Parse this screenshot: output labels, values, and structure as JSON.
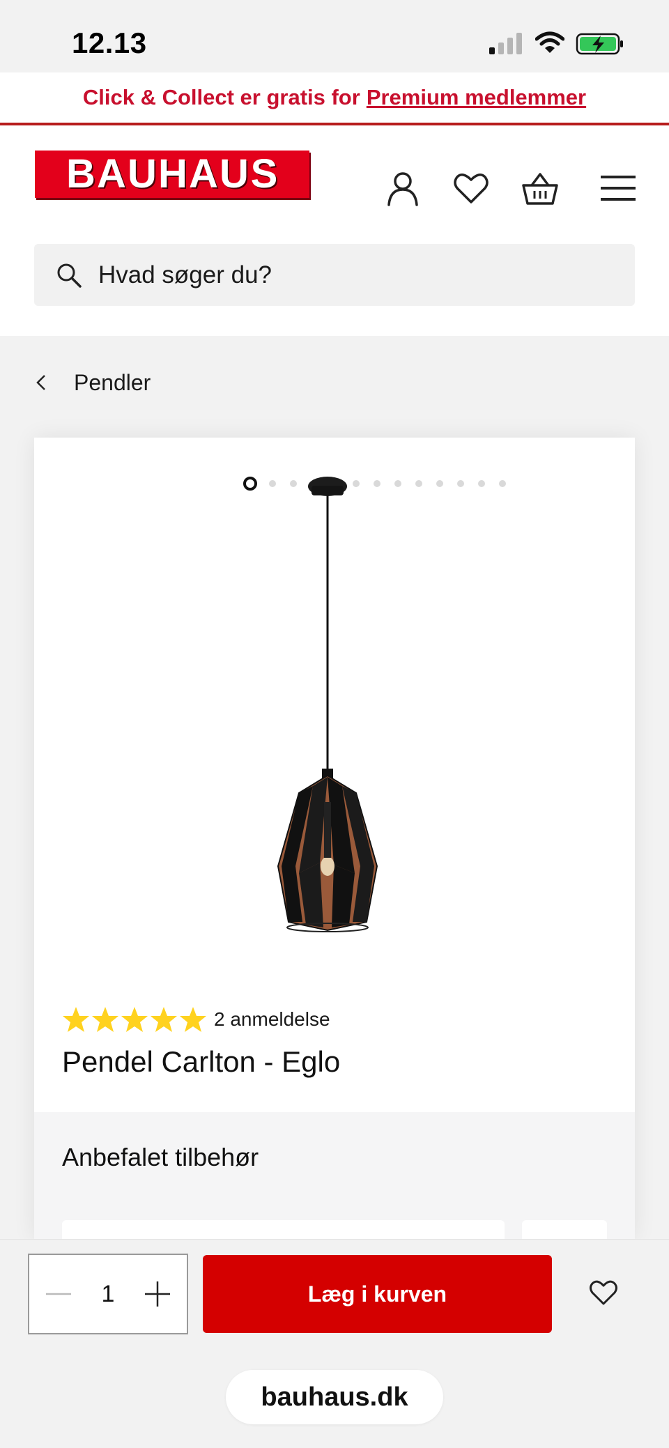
{
  "status_bar": {
    "time": "12.13"
  },
  "promo": {
    "text": "Click & Collect er gratis for",
    "link": "Premium medlemmer"
  },
  "header": {
    "logo_text": "BAUHAUS",
    "icons": [
      "user-icon",
      "heart-icon",
      "basket-icon",
      "menu-icon"
    ]
  },
  "search": {
    "placeholder": "Hvad søger du?"
  },
  "breadcrumb": {
    "label": "Pendler"
  },
  "product": {
    "image_count": 13,
    "active_image_index": 0,
    "rating_stars": 5,
    "reviews_label": "2 anmeldelse",
    "title": "Pendel Carlton - Eglo"
  },
  "accessories": {
    "heading": "Anbefalet tilbehør"
  },
  "cart_bar": {
    "quantity": "1",
    "add_button": "Læg i kurven"
  },
  "browser": {
    "url": "bauhaus.dk"
  },
  "colors": {
    "brand_red": "#e3001b",
    "button_red": "#d40000",
    "promo_red": "#c8102e",
    "star_yellow": "#ffd21f"
  }
}
